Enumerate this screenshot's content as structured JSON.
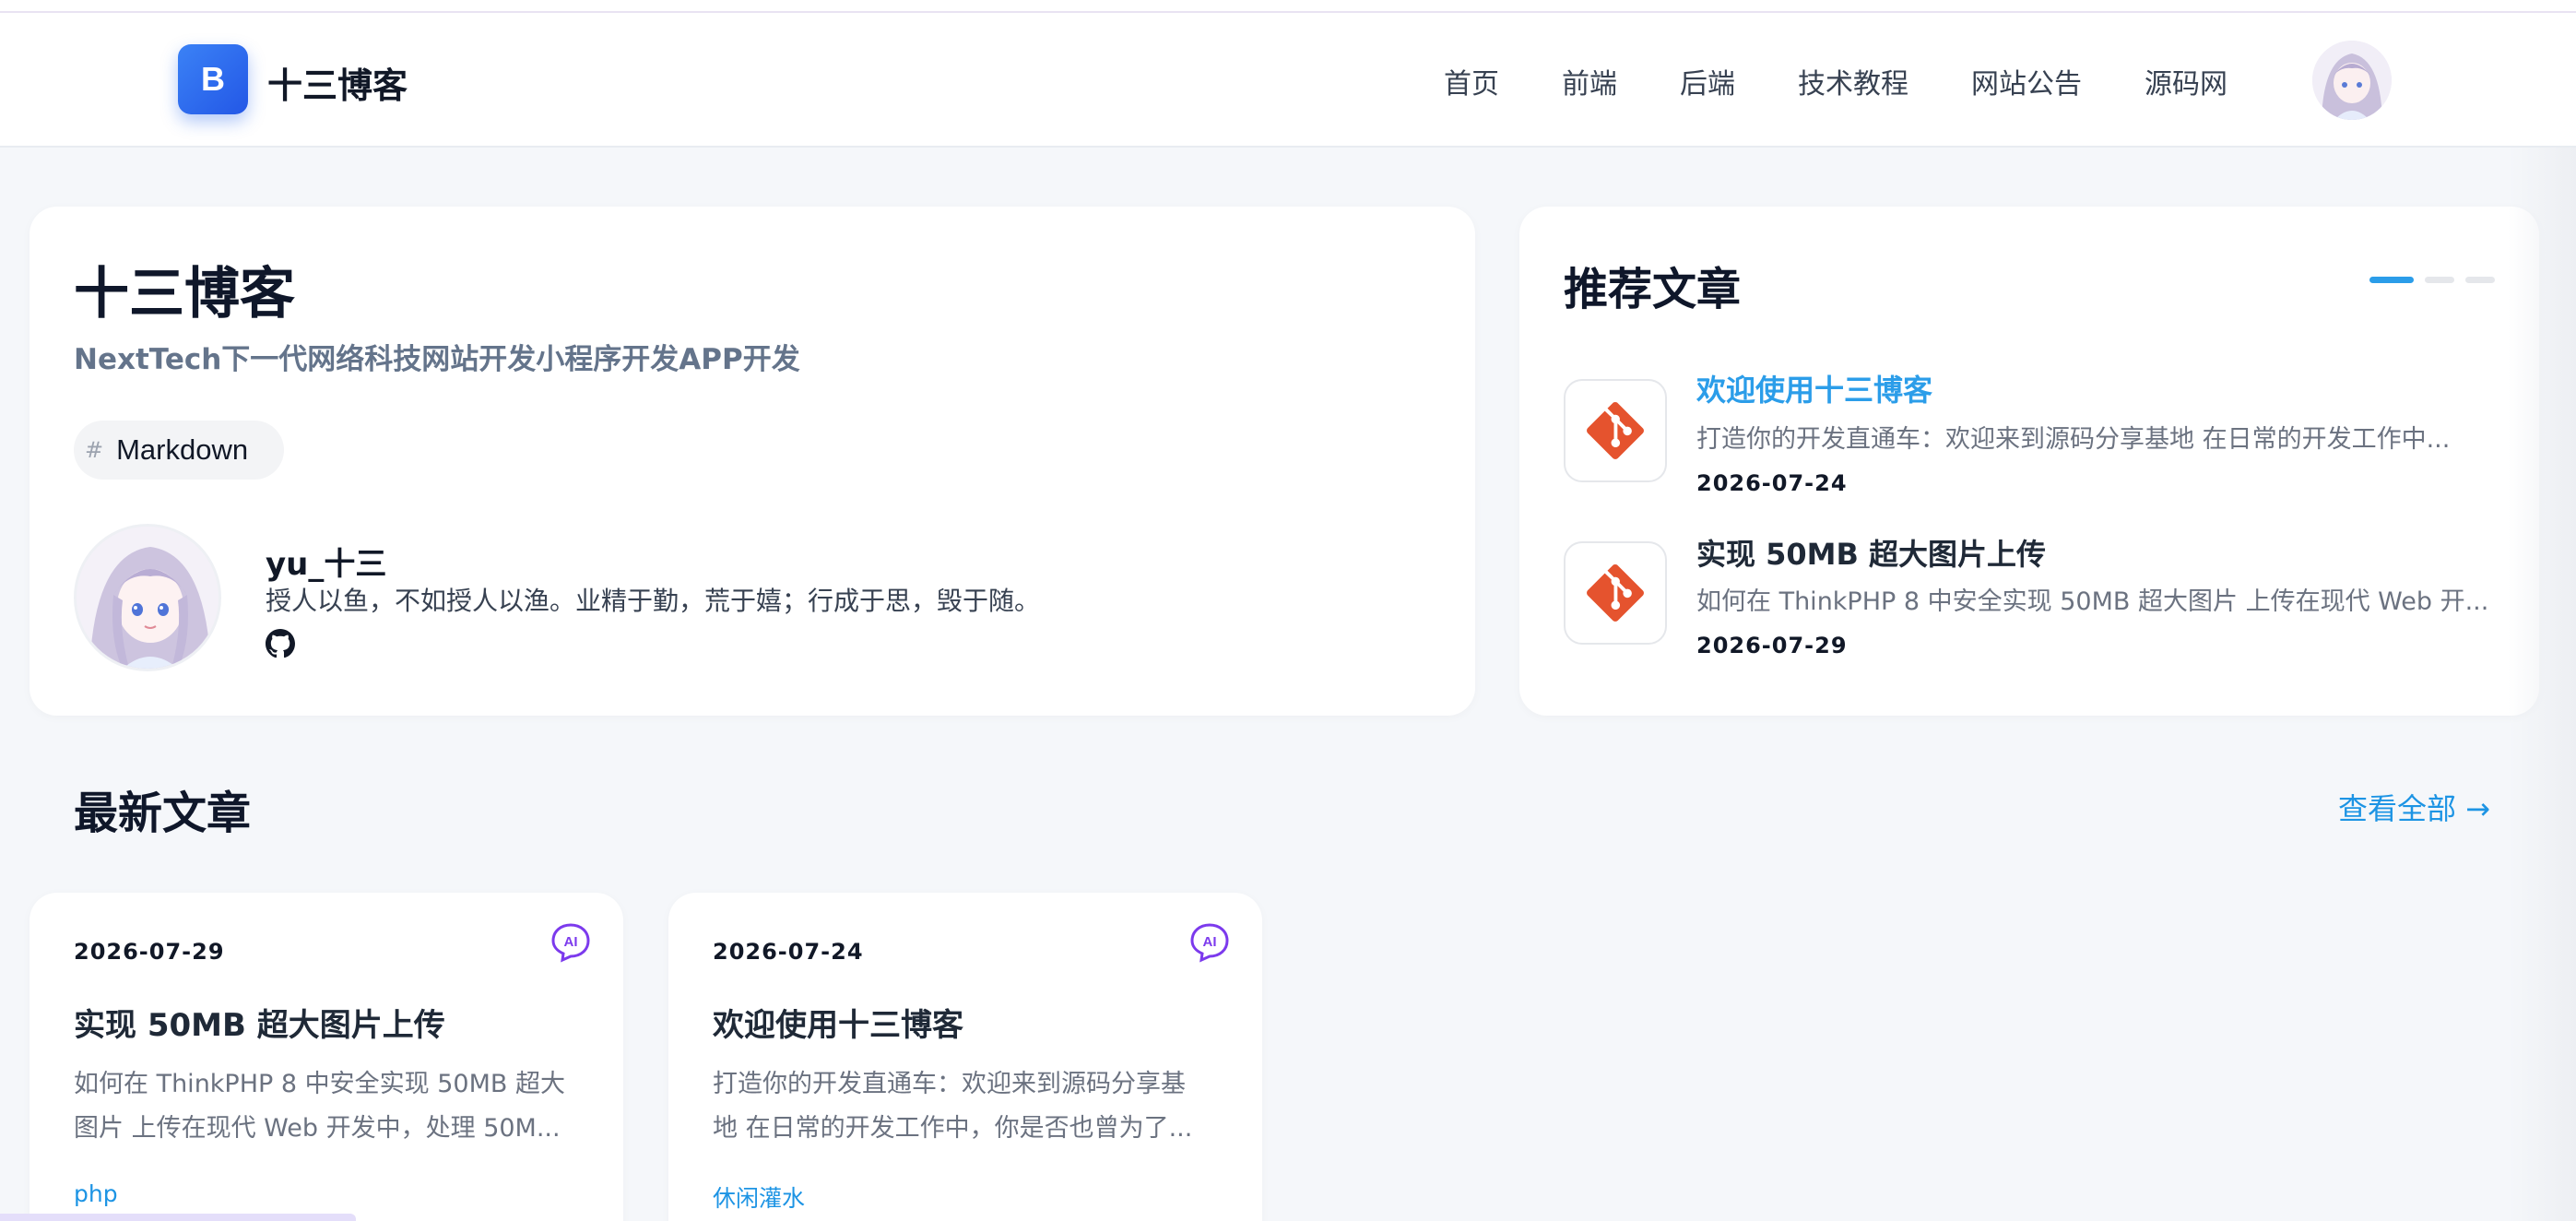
{
  "header": {
    "logo_letter": "B",
    "brand": "十三博客",
    "nav": [
      "首页",
      "前端",
      "后端",
      "技术教程",
      "网站公告",
      "源码网"
    ]
  },
  "profile": {
    "site_title": "十三博客",
    "subtitle": "NextTech下一代网络科技网站开发小程序开发APP开发",
    "tag_hash": "#",
    "tag": "Markdown",
    "author_name": "yu_十三",
    "motto": "授人以鱼，不如授人以渔。业精于勤，荒于嬉；行成于思，毁于随。"
  },
  "recommended": {
    "title": "推荐文章",
    "items": [
      {
        "title": "欢迎使用十三博客",
        "excerpt": "打造你的开发直通车：欢迎来到源码分享基地 在日常的开发工作中...",
        "date": "2026-07-24"
      },
      {
        "title": "实现 50MB 超大图片上传",
        "excerpt": "如何在 ThinkPHP 8 中安全实现 50MB 超大图片 上传在现代 Web 开...",
        "date": "2026-07-29"
      }
    ]
  },
  "latest": {
    "title": "最新文章",
    "view_all": "查看全部 →",
    "posts": [
      {
        "date": "2026-07-29",
        "title": "实现 50MB 超大图片上传",
        "excerpt_line1": "如何在 ThinkPHP 8 中安全实现 50MB 超大",
        "excerpt_line2": "图片 上传在现代 Web 开发中，处理 50M...",
        "tag": "php"
      },
      {
        "date": "2026-07-24",
        "title": "欢迎使用十三博客",
        "excerpt_line1": "打造你的开发直通车：欢迎来到源码分享基",
        "excerpt_line2": "地 在日常的开发工作中，你是否也曾为了...",
        "tag": "休闲灌水"
      }
    ]
  },
  "colors": {
    "accent": "#2b9de9",
    "git_icon": "#e5532e",
    "ai_icon": "#7c3aed",
    "logo_gradient_start": "#3b82f6",
    "logo_gradient_end": "#2357e6"
  }
}
